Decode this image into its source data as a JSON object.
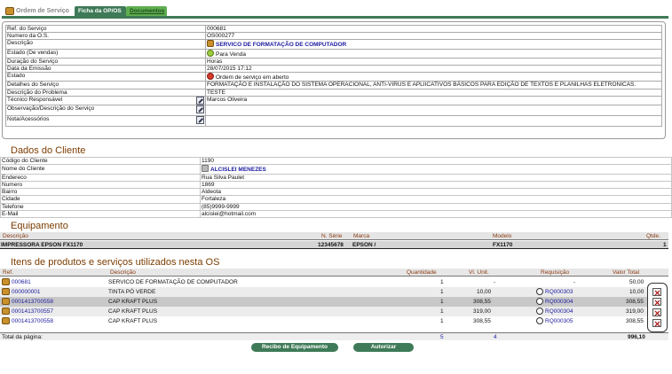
{
  "header": {
    "breadcrumb": "Ordem de Serviço",
    "tabs": [
      {
        "label": "Ficha da OP/OS"
      },
      {
        "label": "Documentos"
      }
    ]
  },
  "os": {
    "rows": [
      {
        "label": "Ref. do Serviço",
        "value": "000681"
      },
      {
        "label": "Numero da O.S.",
        "value": "OS000277"
      },
      {
        "label": "Descrição",
        "value": "SERVICO DE FORMATAÇÃO DE COMPUTADOR"
      },
      {
        "label": "Estado (De vendas)",
        "value": "Para Venda"
      },
      {
        "label": "Duração do Serviço",
        "value": "Horas"
      },
      {
        "label": "Data da Emissão",
        "value": "28/07/2015 17:12"
      },
      {
        "label": "Estado",
        "value": "Ordem de serviço em aberto"
      },
      {
        "label": "Detalhes do Serviço",
        "value": "FORMATAÇÃO E INSTALAÇÃO DO SISTEMA OPERACIONAL, ANTI-VIRUS E APLIICATIVOS BÁSICOS PARA EDIÇÃO DE TEXTOS E PLANILHAS ELETRONICAS."
      },
      {
        "label": "Descrição do Problema",
        "value": "TESTE"
      },
      {
        "label": "Técnico Responsável",
        "value": "Marcos Oliveira"
      },
      {
        "label": "Observação/Descrição do Serviço",
        "value": ""
      },
      {
        "label": "Nota/Acessórios",
        "value": ""
      }
    ]
  },
  "cliente": {
    "title": "Dados do Cliente",
    "rows": [
      {
        "label": "Código do Cliente",
        "value": "1190"
      },
      {
        "label": "Nome do Cliente",
        "value": "ALCISLEI MENEZES"
      },
      {
        "label": "Endereco",
        "value": "Rua Silva Paulet"
      },
      {
        "label": "Numero",
        "value": "1869"
      },
      {
        "label": "Bairro",
        "value": "Aldeota"
      },
      {
        "label": "Cidade",
        "value": "Fortaleza"
      },
      {
        "label": "Telefone",
        "value": "(85)9999-9999"
      },
      {
        "label": "E-Mail",
        "value": "alcislei@hotmail.com"
      }
    ]
  },
  "equipamento": {
    "title": "Equipamento",
    "headers": {
      "descricao": "Descrição",
      "serie": "N. Série",
      "marca": "Marca",
      "modelo": "Modelo",
      "qtde": "Qtde."
    },
    "row": {
      "descricao": "IMPRESSORA EPSON FX1170",
      "serie": "12345678",
      "marca": "EPSON /",
      "modelo": "FX1170",
      "qtde": "1"
    }
  },
  "itens": {
    "title": "Itens de produtos e serviços utilizados nesta OS",
    "headers": {
      "ref": "Ref.",
      "descricao": "Descrição",
      "quantidade": "Quantidade",
      "unit": "Vl. Unit.",
      "requisicao": "Requisição",
      "total": "Valor Total"
    },
    "rows": [
      {
        "ref": "000681",
        "descricao": "SERVICO DE FORMATAÇÃO DE COMPUTADOR",
        "quantidade": "1",
        "unit": "-",
        "requisicao": "-",
        "total": "50,00"
      },
      {
        "ref": "000000001",
        "descricao": "TINTA PÓ VERDE",
        "quantidade": "1",
        "unit": "10,00",
        "requisicao": "RQ000303",
        "total": "10,00"
      },
      {
        "ref": "0001413700558",
        "descricao": "CAP KRAFT PLUS",
        "quantidade": "1",
        "unit": "308,55",
        "requisicao": "RQ000304",
        "total": "308,55"
      },
      {
        "ref": "0001413700557",
        "descricao": "CAP KRAFT PLUS",
        "quantidade": "1",
        "unit": "319,00",
        "requisicao": "RQ000304",
        "total": "319,00"
      },
      {
        "ref": "0001413700558",
        "descricao": "CAP KRAFT PLUS",
        "quantidade": "1",
        "unit": "308,55",
        "requisicao": "RQ000305",
        "total": "308,55"
      }
    ],
    "total": {
      "label": "Total da página:",
      "quantidade": "5",
      "unit": "4",
      "total": "996,10"
    }
  },
  "buttons": {
    "recibo": "Recibo de Equipamento",
    "autorizar": "Autorizar"
  }
}
